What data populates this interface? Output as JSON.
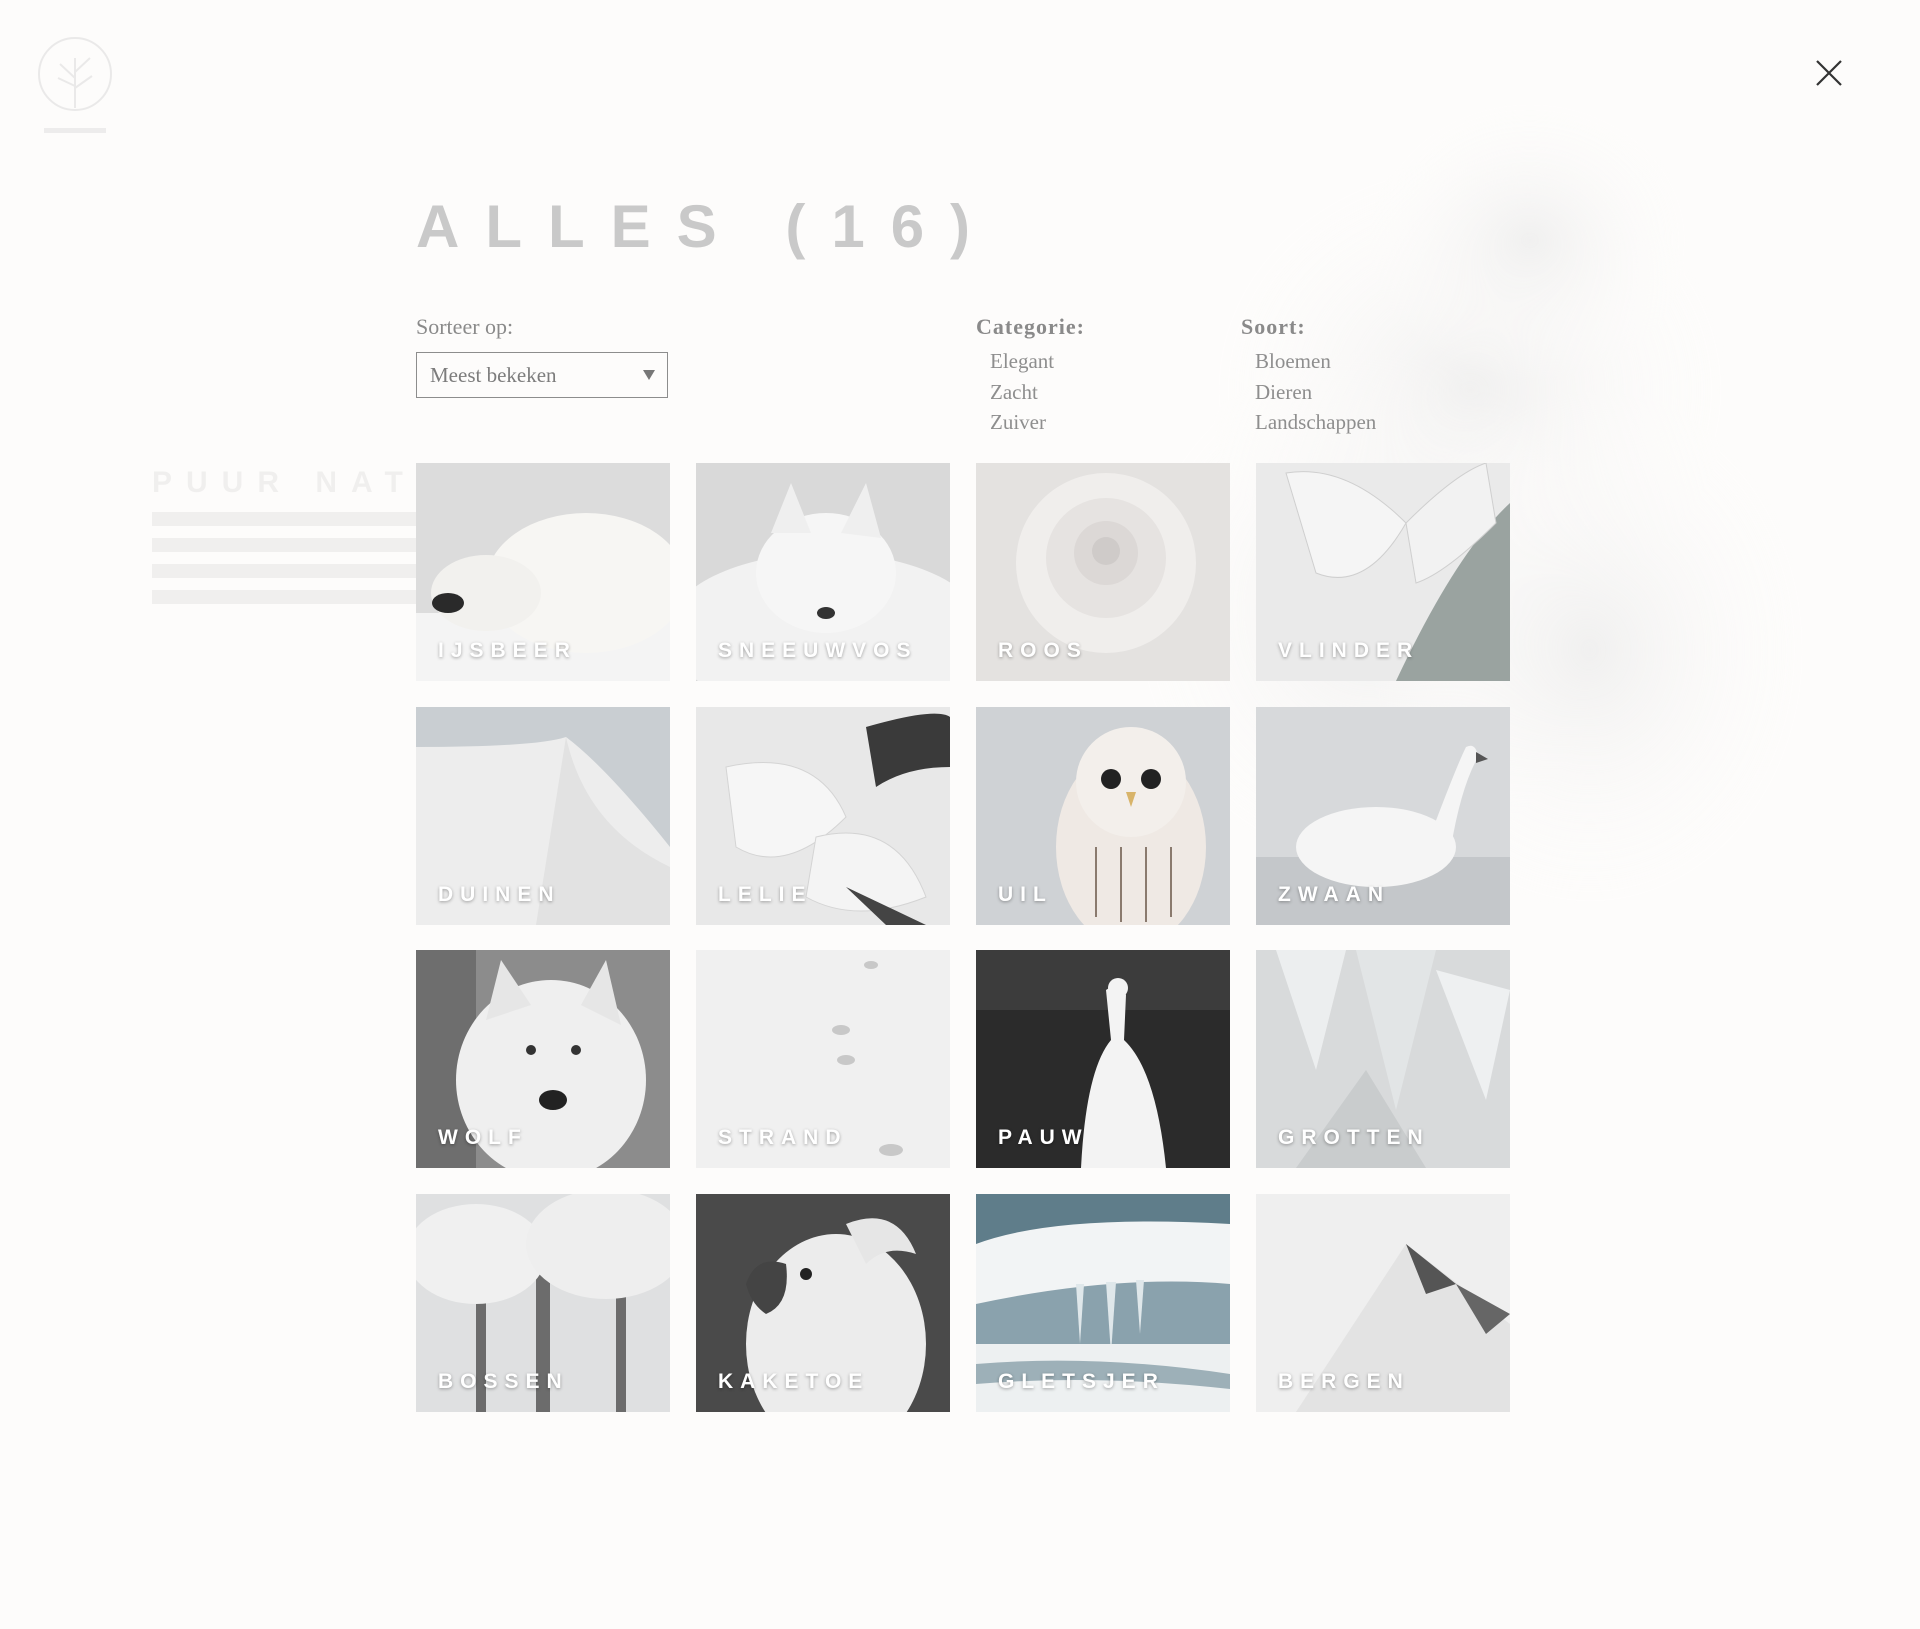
{
  "logo": {
    "icon": "tree-logo-icon"
  },
  "header": {
    "close_icon": "close-icon"
  },
  "title": "ALLES (16)",
  "sort": {
    "label": "Sorteer op:",
    "value": "Meest bekeken",
    "icon": "chevron-down-icon"
  },
  "filters": {
    "category": {
      "label": "Categorie:",
      "options": [
        "Elegant",
        "Zacht",
        "Zuiver"
      ]
    },
    "type": {
      "label": "Soort:",
      "options": [
        "Bloemen",
        "Dieren",
        "Landschappen"
      ]
    }
  },
  "tiles": [
    {
      "label": "IJSBEER"
    },
    {
      "label": "SNEEUWVOS"
    },
    {
      "label": "ROOS"
    },
    {
      "label": "VLINDER"
    },
    {
      "label": "DUINEN"
    },
    {
      "label": "LELIE"
    },
    {
      "label": "UIL"
    },
    {
      "label": "ZWAAN"
    },
    {
      "label": "WOLF"
    },
    {
      "label": "STRAND"
    },
    {
      "label": "PAUW"
    },
    {
      "label": "GROTTEN"
    },
    {
      "label": "BOSSEN"
    },
    {
      "label": "KAKETOE"
    },
    {
      "label": "GLETSJER"
    },
    {
      "label": "BERGEN"
    }
  ]
}
